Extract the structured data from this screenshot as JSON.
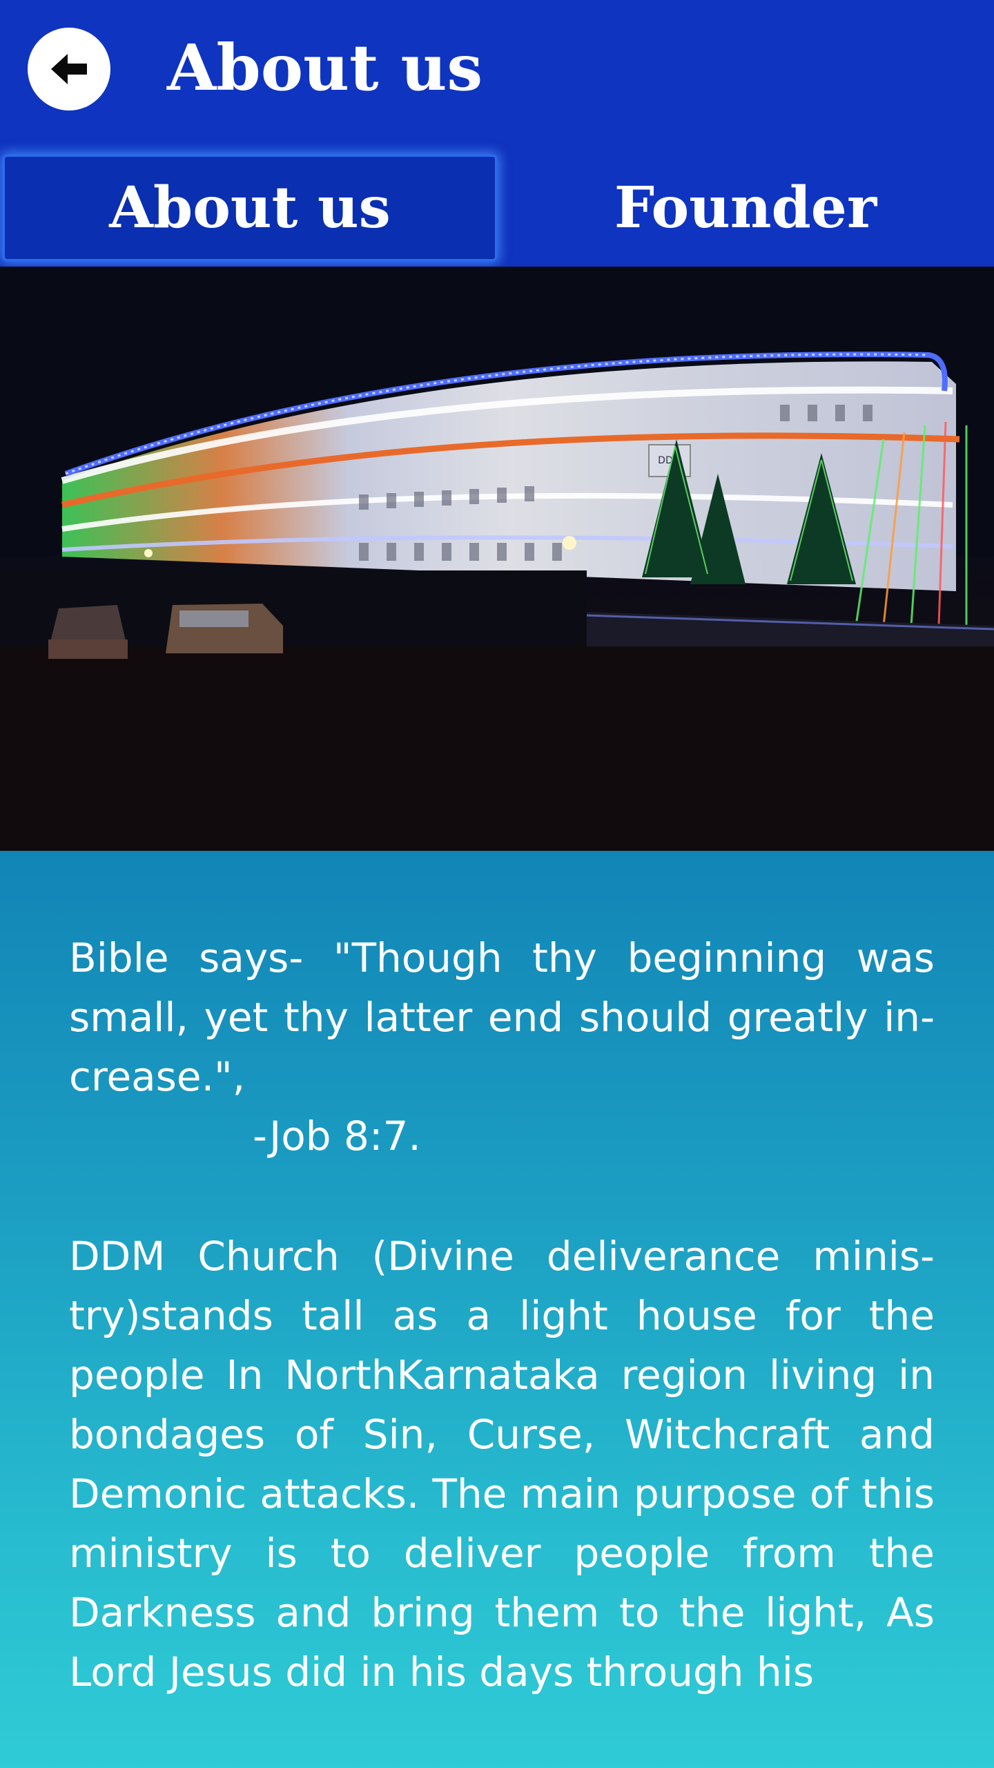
{
  "header": {
    "title": "About us",
    "back_icon": "arrow-left-icon"
  },
  "tabs": [
    {
      "label": "About us",
      "selected": true
    },
    {
      "label": "Founder",
      "selected": false
    }
  ],
  "hero": {
    "sign_text": "DDM"
  },
  "content": {
    "quote": "Bible says- \"Though thy beginning was small, yet thy latter end should greatly in-crease.\",",
    "quote_reference": "-Job 8:7.",
    "description": "DDM Church (Divine deliverance minis-try)stands tall as a light house for the people In NorthKarnataka region living in bondages of Sin, Curse, Witchcraft and Demonic attacks. The main purpose of this ministry is to deliver people from the Darkness and bring them to the light, As Lord Jesus did in his days through his"
  },
  "colors": {
    "app_bar": "#0f34bf",
    "content_top": "#1285b6",
    "content_bottom": "#2fcbd6",
    "text": "#ffffff"
  }
}
